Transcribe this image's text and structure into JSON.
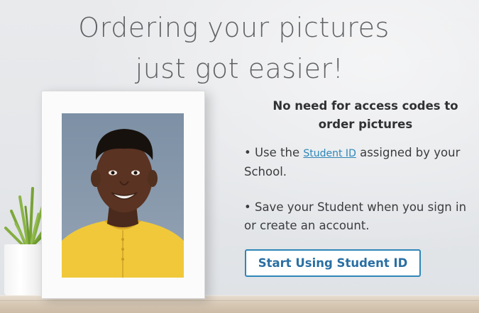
{
  "hero": {
    "headline_line1": "Ordering your pictures",
    "headline_line2": "just got easier!"
  },
  "info": {
    "tagline": "No need for access codes to order pictures",
    "bullet1_prefix": "• Use the ",
    "bullet1_link": "Student ID",
    "bullet1_suffix": " assigned by your School.",
    "bullet2": "• Save your Student when you sign in or create an account."
  },
  "cta": {
    "label": "Start Using Student ID"
  },
  "colors": {
    "accent": "#2e86b8",
    "headline": "#606264",
    "wall": "#e6e8eb"
  },
  "icons": [
    "potted-plant-icon",
    "photo-frame-icon"
  ]
}
